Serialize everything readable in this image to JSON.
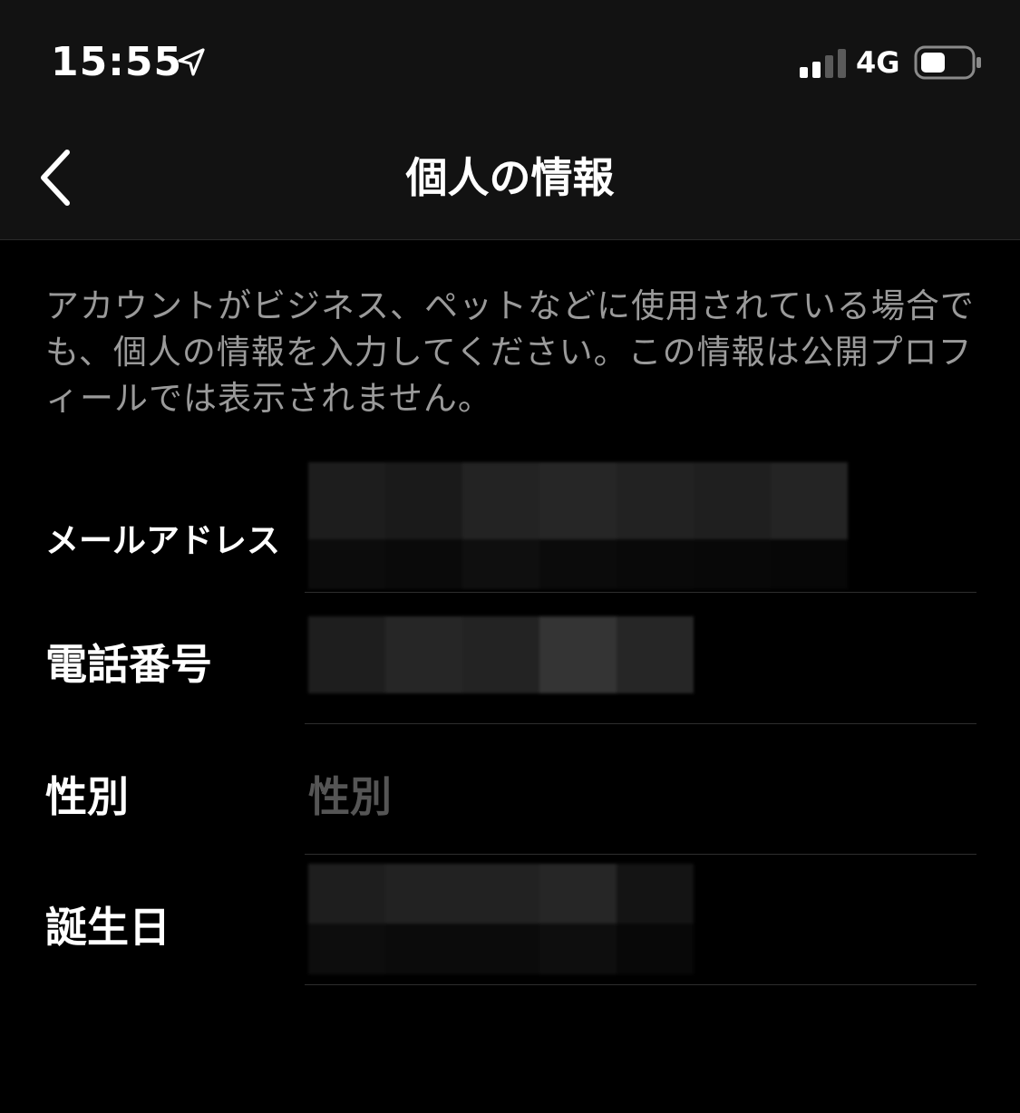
{
  "status_bar": {
    "time": "15:55",
    "network": "4G",
    "location_icon": "location-arrow-icon",
    "signal_icon": "signal-bars-icon",
    "battery_icon": "battery-icon"
  },
  "nav": {
    "title": "個人の情報",
    "back_icon": "chevron-left-icon"
  },
  "description": "アカウントがビジネス、ペットなどに使用されている場合でも、個人の情報を入力してください。この情報は公開プロフィールでは表示されません。",
  "fields": [
    {
      "label": "メールアドレス",
      "value": "",
      "placeholder": "",
      "redacted": true
    },
    {
      "label": "電話番号",
      "value": "",
      "placeholder": "",
      "redacted": true
    },
    {
      "label": "性別",
      "value": "",
      "placeholder": "性別",
      "redacted": false
    },
    {
      "label": "誕生日",
      "value": "",
      "placeholder": "",
      "redacted": true
    }
  ],
  "colors": {
    "background": "#000000",
    "bar_background": "#121212",
    "secondary_text": "#9a9a9a",
    "placeholder_text": "#555555",
    "divider": "#2e2e2e"
  }
}
